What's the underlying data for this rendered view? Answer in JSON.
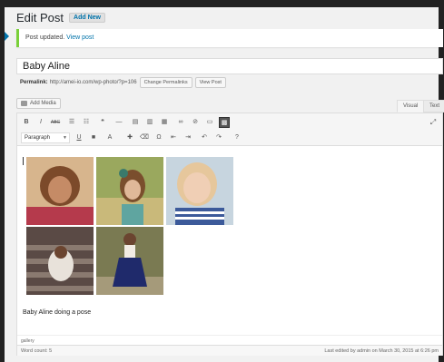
{
  "header": {
    "title": "Edit Post",
    "add_new_label": "Add New"
  },
  "notice": {
    "text": "Post updated.",
    "link": "View post"
  },
  "post": {
    "title": "Baby Aline",
    "permalink_label": "Permalink:",
    "permalink_url": "http://amei-io.com/wp-photo/?p=106",
    "change_permalinks_label": "Change Permalinks",
    "view_post_label": "View Post"
  },
  "editor": {
    "add_media_label": "Add Media",
    "tab_visual": "Visual",
    "tab_text": "Text",
    "format_value": "Paragraph",
    "content_caption": "Baby Aline doing a pose",
    "status_path": "gallery",
    "word_count": "Word count: 5",
    "last_edited": "Last edited by admin on March 30, 2015 at 6:26 pm"
  },
  "toolbar": {
    "row1": [
      {
        "name": "bold-button",
        "glyph": "B"
      },
      {
        "name": "italic-button",
        "glyph": "I"
      },
      {
        "name": "strikethrough-button",
        "glyph": "ABC"
      },
      {
        "name": "bulleted-list-button",
        "glyph": "☰"
      },
      {
        "name": "numbered-list-button",
        "glyph": "☷"
      },
      {
        "name": "blockquote-button",
        "glyph": "❝"
      },
      {
        "name": "horizontal-line-button",
        "glyph": "—"
      },
      {
        "name": "align-left-button",
        "glyph": "▤"
      },
      {
        "name": "align-center-button",
        "glyph": "▥"
      },
      {
        "name": "align-right-button",
        "glyph": "▦"
      },
      {
        "name": "insert-link-button",
        "glyph": "∞"
      },
      {
        "name": "remove-link-button",
        "glyph": "⊘"
      },
      {
        "name": "read-more-button",
        "glyph": "▭"
      },
      {
        "name": "toolbar-toggle-button",
        "glyph": "▩"
      }
    ],
    "row2": [
      {
        "name": "underline-button",
        "glyph": "U"
      },
      {
        "name": "justify-button",
        "glyph": "■"
      },
      {
        "name": "text-color-button",
        "glyph": "A"
      },
      {
        "name": "paste-as-text-button",
        "glyph": "✚"
      },
      {
        "name": "clear-formatting-button",
        "glyph": "⌫"
      },
      {
        "name": "special-character-button",
        "glyph": "Ω"
      },
      {
        "name": "outdent-button",
        "glyph": "⇤"
      },
      {
        "name": "indent-button",
        "glyph": "⇥"
      },
      {
        "name": "undo-button",
        "glyph": "↶"
      },
      {
        "name": "redo-button",
        "glyph": "↷"
      },
      {
        "name": "help-button",
        "glyph": "?"
      }
    ]
  },
  "gallery": {
    "photos": [
      {
        "name": "photo-curly-hair-child",
        "bg": "#c98a58"
      },
      {
        "name": "photo-girl-flower-headband",
        "bg": "#8ea35a"
      },
      {
        "name": "photo-smiling-toddler",
        "bg": "#8aaac4"
      },
      {
        "name": "photo-girl-on-stairs",
        "bg": "#6a5048"
      },
      {
        "name": "photo-girl-navy-dress",
        "bg": "#6e6a45"
      }
    ]
  },
  "colors": {
    "accent": "#0073aa",
    "notice_border": "#7ad03a",
    "admin_bar": "#222222"
  }
}
